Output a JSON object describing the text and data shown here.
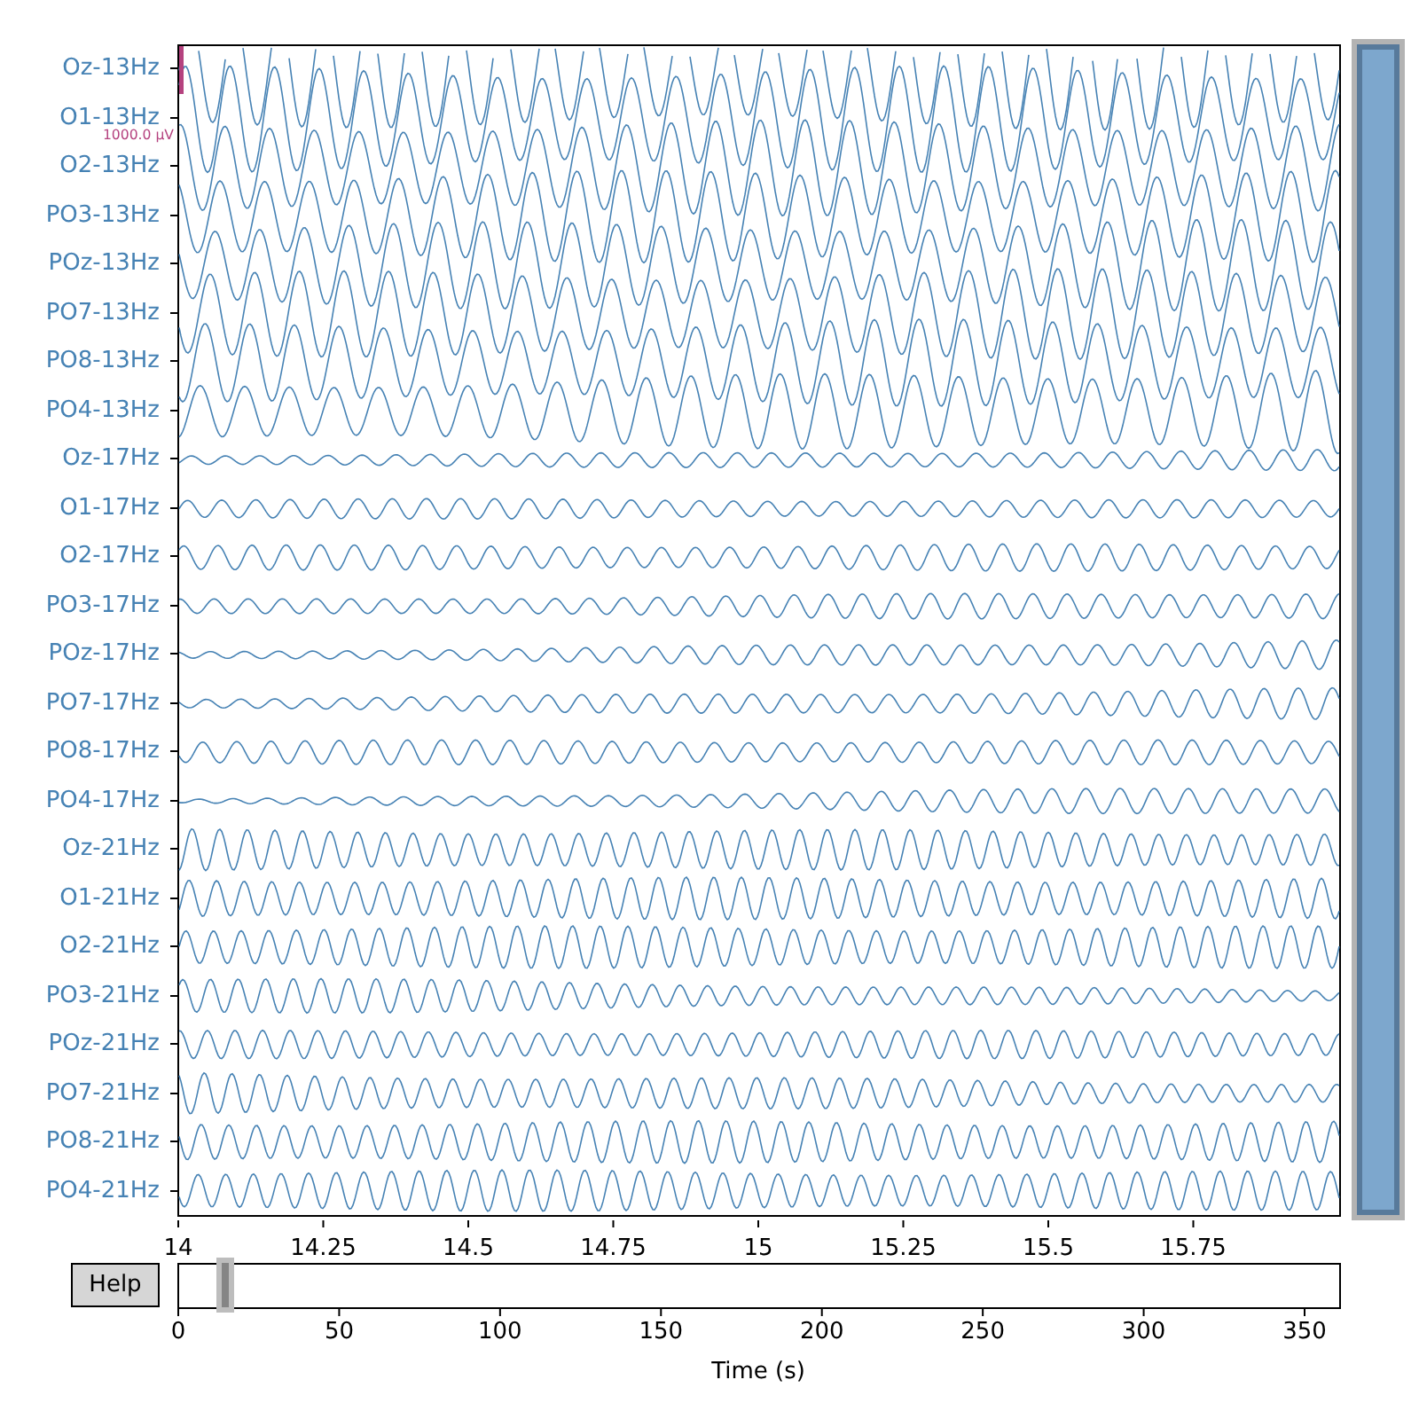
{
  "channels": [
    {
      "label": "Oz-13Hz"
    },
    {
      "label": "O1-13Hz"
    },
    {
      "label": "O2-13Hz"
    },
    {
      "label": "PO3-13Hz"
    },
    {
      "label": "POz-13Hz"
    },
    {
      "label": "PO7-13Hz"
    },
    {
      "label": "PO8-13Hz"
    },
    {
      "label": "PO4-13Hz"
    },
    {
      "label": "Oz-17Hz"
    },
    {
      "label": "O1-17Hz"
    },
    {
      "label": "O2-17Hz"
    },
    {
      "label": "PO3-17Hz"
    },
    {
      "label": "POz-17Hz"
    },
    {
      "label": "PO7-17Hz"
    },
    {
      "label": "PO8-17Hz"
    },
    {
      "label": "PO4-17Hz"
    },
    {
      "label": "Oz-21Hz"
    },
    {
      "label": "O1-21Hz"
    },
    {
      "label": "O2-21Hz"
    },
    {
      "label": "PO3-21Hz"
    },
    {
      "label": "POz-21Hz"
    },
    {
      "label": "PO7-21Hz"
    },
    {
      "label": "PO8-21Hz"
    },
    {
      "label": "PO4-21Hz"
    }
  ],
  "scale_bar": {
    "label": "1000.0 µV"
  },
  "time_axis": {
    "ticks": [
      "14",
      "14.25",
      "14.5",
      "14.75",
      "15",
      "15.25",
      "15.5",
      "15.75"
    ]
  },
  "help_button": {
    "label": "Help"
  },
  "overview": {
    "ticks": [
      "0",
      "50",
      "100",
      "150",
      "200",
      "250",
      "300",
      "350"
    ],
    "xlabel": "Time (s)"
  }
}
